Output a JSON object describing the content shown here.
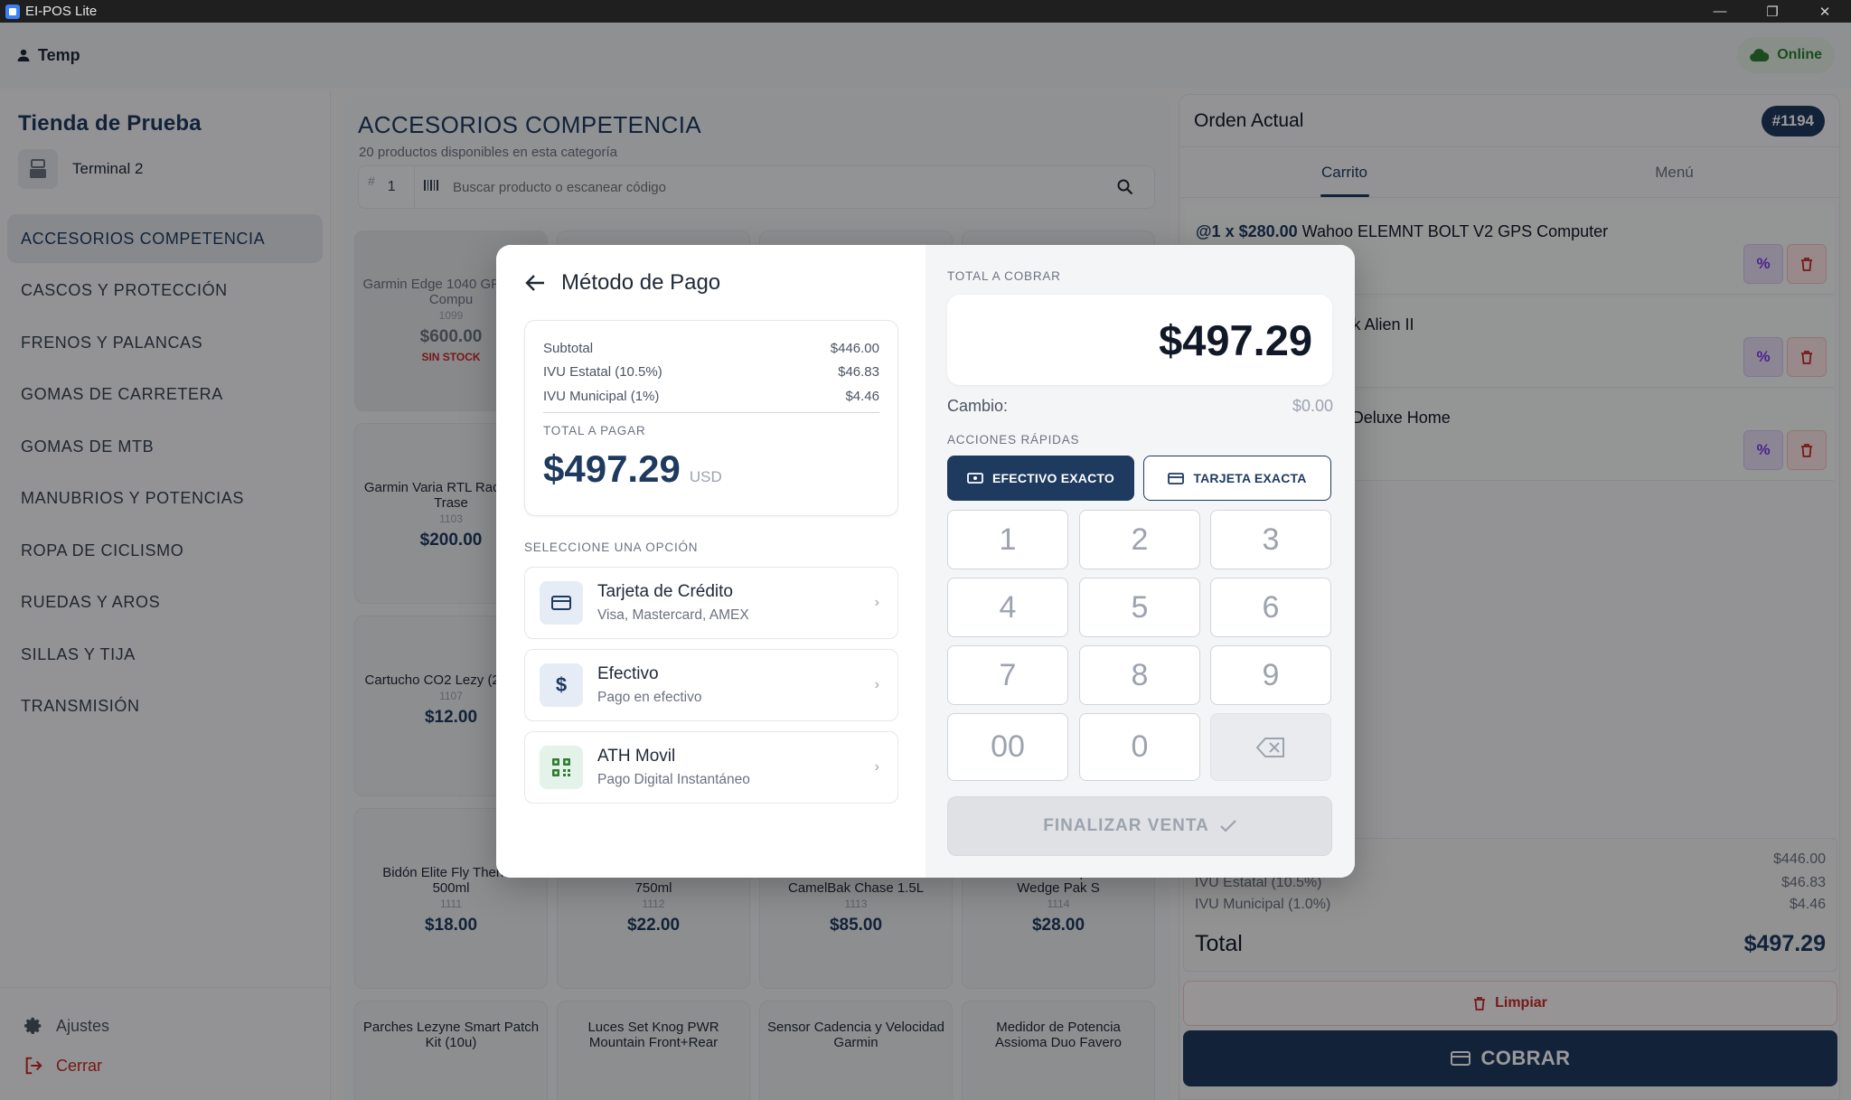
{
  "window": {
    "title": "EI-POS Lite"
  },
  "header": {
    "user": "Temp",
    "status": "Online"
  },
  "sidebar": {
    "store_name": "Tienda de Prueba",
    "terminal": "Terminal 2",
    "categories": [
      "ACCESORIOS COMPETENCIA",
      "CASCOS Y PROTECCIÓN",
      "FRENOS Y PALANCAS",
      "GOMAS DE CARRETERA",
      "GOMAS DE MTB",
      "MANUBRIOS Y POTENCIAS",
      "ROPA DE CICLISMO",
      "RUEDAS Y AROS",
      "SILLAS Y TIJA",
      "TRANSMISIÓN"
    ],
    "settings": "Ajustes",
    "logout": "Cerrar"
  },
  "main": {
    "title": "ACCESORIOS COMPETENCIA",
    "subtitle": "20 productos disponibles en esta categoría",
    "qty_symbol": "#",
    "qty_value": "1",
    "search_placeholder": "Buscar producto o escanear código",
    "products": [
      {
        "name": "Garmin Edge 1040 GPS Bike Compu",
        "id": "1099",
        "price": "$600.00",
        "stock": "SIN STOCK"
      },
      {
        "name": "Garmin Varia RTL Radar Luz Trase",
        "id": "1103",
        "price": "$200.00"
      },
      {
        "name": "Cartucho CO2 Lezy (2-pack)",
        "id": "1107",
        "price": "$12.00"
      },
      {
        "name": "Bidón Elite Fly Thermo 500ml",
        "id": "1111",
        "price": "$18.00"
      },
      {
        "name": "Bidón CamelBak Chute Elite 750ml",
        "id": "1112",
        "price": "$22.00"
      },
      {
        "name": "Mochila Hidratación CamelBak Chase 1.5L",
        "id": "1113",
        "price": "$85.00"
      },
      {
        "name": "Bolsa de Sillín Topeak Aero Wedge Pak S",
        "id": "1114",
        "price": "$28.00"
      },
      {
        "name": "Parches Lezyne Smart Patch Kit (10u)"
      },
      {
        "name": "Luces Set Knog PWR Mountain Front+Rear"
      },
      {
        "name": "Sensor Cadencia y Velocidad Garmin"
      },
      {
        "name": "Medidor de Potencia Assioma Duo Favero"
      }
    ]
  },
  "order": {
    "title": "Orden Actual",
    "number": "#1194",
    "tabs": [
      "Carrito",
      "Menú"
    ],
    "lines": [
      {
        "qty": "@1 x $280.00",
        "name": "Wahoo ELEMNT BOLT V2 GPS Computer"
      },
      {
        "name": "ienta Multi Tool Topeak Alien II"
      },
      {
        "name": "paraciones Park Tool Deluxe Home"
      }
    ],
    "subtotal": "$446.00",
    "ivu_estatal_label": "IVU Estatal (10.5%)",
    "ivu_estatal": "$46.83",
    "ivu_municipal_label": "IVU Municipal (1.0%)",
    "ivu_municipal": "$4.46",
    "total_label": "Total",
    "total": "$497.29",
    "clear": "Limpiar",
    "charge": "COBRAR"
  },
  "modal": {
    "title": "Método de Pago",
    "summary": {
      "subtotal_label": "Subtotal",
      "subtotal": "$446.00",
      "ivu_estatal_label": "IVU Estatal (10.5%)",
      "ivu_estatal": "$46.83",
      "ivu_municipal_label": "IVU Municipal (1%)",
      "ivu_municipal": "$4.46",
      "total_label": "TOTAL A PAGAR",
      "total": "$497.29",
      "currency": "USD"
    },
    "options_label": "SELECCIONE UNA OPCIÓN",
    "options": [
      {
        "name": "Tarjeta de Crédito",
        "desc": "Visa, Mastercard, AMEX"
      },
      {
        "name": "Efectivo",
        "desc": "Pago en efectivo"
      },
      {
        "name": "ATH Movil",
        "desc": "Pago Digital Instantáneo"
      }
    ],
    "charge_label": "TOTAL A COBRAR",
    "charge_amount": "$497.29",
    "change_label": "Cambio:",
    "change_value": "$0.00",
    "quick_label": "ACCIONES RÁPIDAS",
    "quick_cash": "EFECTIVO EXACTO",
    "quick_card": "TARJETA EXACTA",
    "keys": [
      "1",
      "2",
      "3",
      "4",
      "5",
      "6",
      "7",
      "8",
      "9",
      "00",
      "0"
    ],
    "finish": "FINALIZAR VENTA"
  },
  "colors": {
    "primary": "#1e3a5f",
    "danger": "#c62828",
    "online": "#2e7d32",
    "accent_purple": "#7c3aed"
  }
}
